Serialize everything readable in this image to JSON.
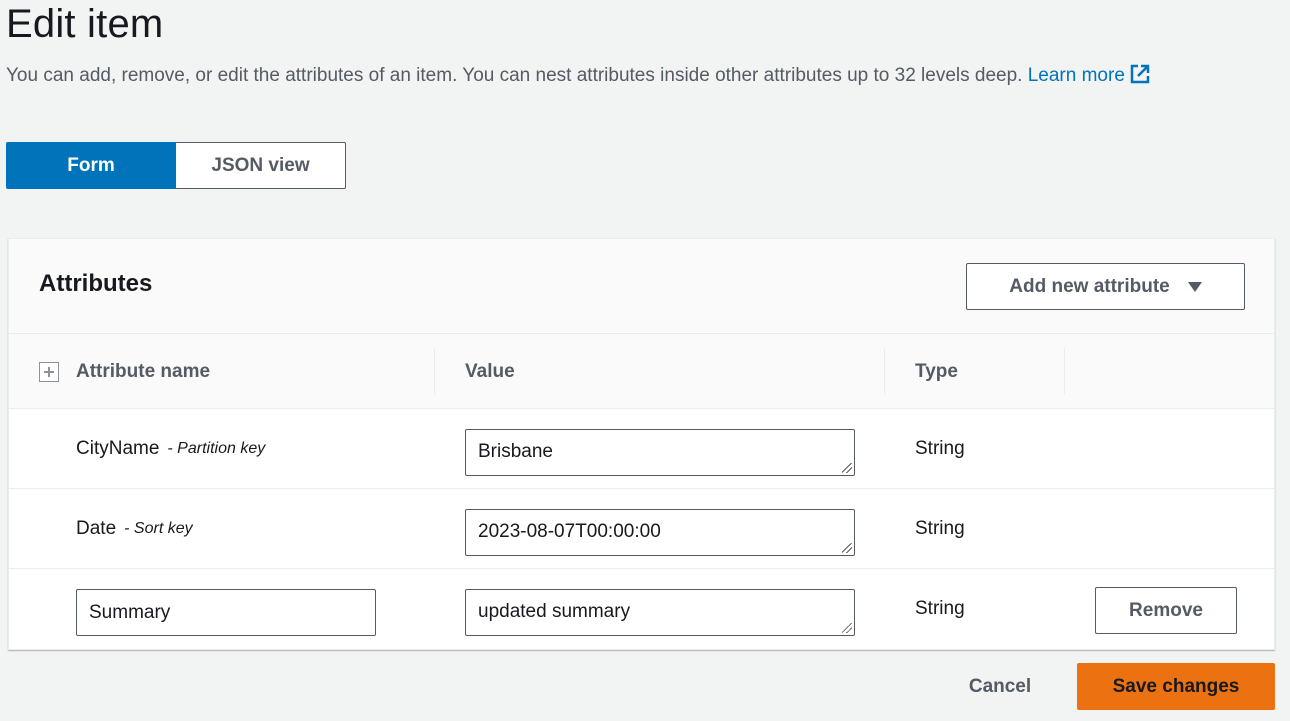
{
  "page": {
    "title": "Edit item",
    "description": "You can add, remove, or edit the attributes of an item. You can nest attributes inside other attributes up to 32 levels deep.",
    "learn_more": "Learn more",
    "link_color": "#0073bb"
  },
  "view_toggle": {
    "options": [
      "Form",
      "JSON view"
    ],
    "selected": "Form"
  },
  "attributes": {
    "title": "Attributes",
    "add_button": "Add new attribute",
    "columns": {
      "name": "Attribute name",
      "value": "Value",
      "type": "Type"
    },
    "rows": [
      {
        "name": "CityName",
        "key_label": "- Partition key",
        "value": "Brisbane",
        "type": "String"
      },
      {
        "name": "Date",
        "key_label": "- Sort key",
        "value": "2023-08-07T00:00:00",
        "type": "String"
      },
      {
        "name": "Summary",
        "value": "updated summary",
        "type": "String",
        "remove_label": "Remove"
      }
    ]
  },
  "footer": {
    "cancel": "Cancel",
    "save": "Save changes",
    "save_color": "#ec7211"
  }
}
